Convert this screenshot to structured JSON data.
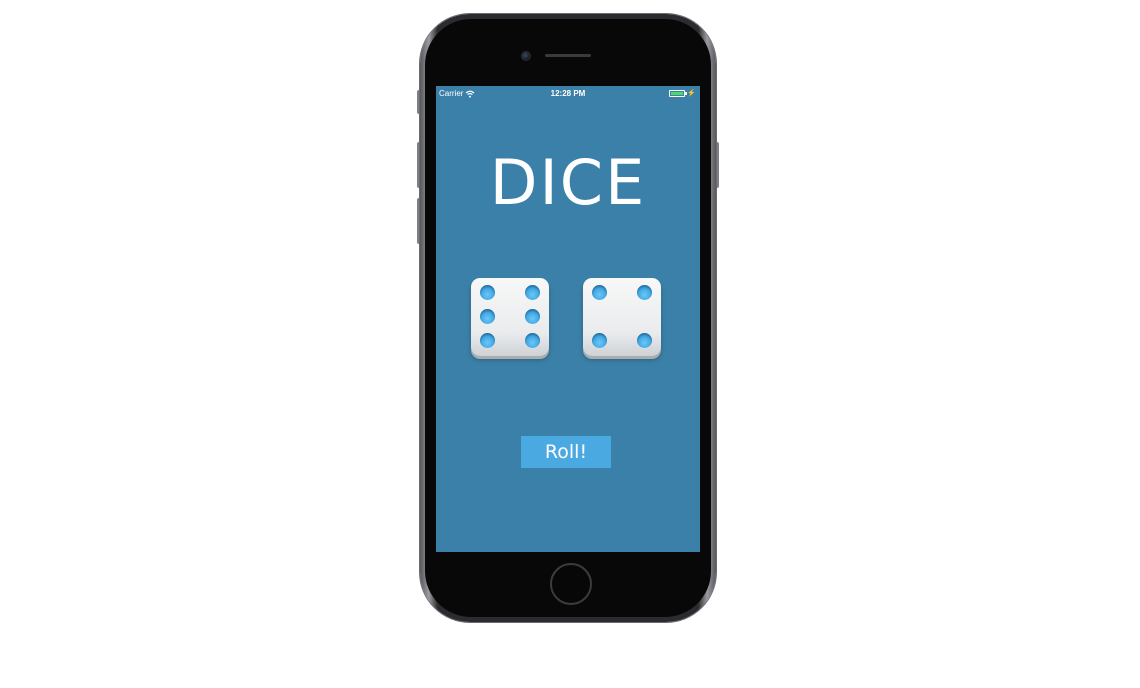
{
  "status_bar": {
    "carrier": "Carrier",
    "time": "12:28 PM"
  },
  "app": {
    "title": "DICE",
    "roll_label": "Roll!",
    "background_color": "#3b80a8",
    "button_color": "#4ba9e2"
  },
  "dice": [
    {
      "value": 6
    },
    {
      "value": 4
    }
  ],
  "icons": {
    "wifi": "wifi-icon",
    "battery": "battery-icon",
    "charging": "charging-bolt-icon"
  }
}
